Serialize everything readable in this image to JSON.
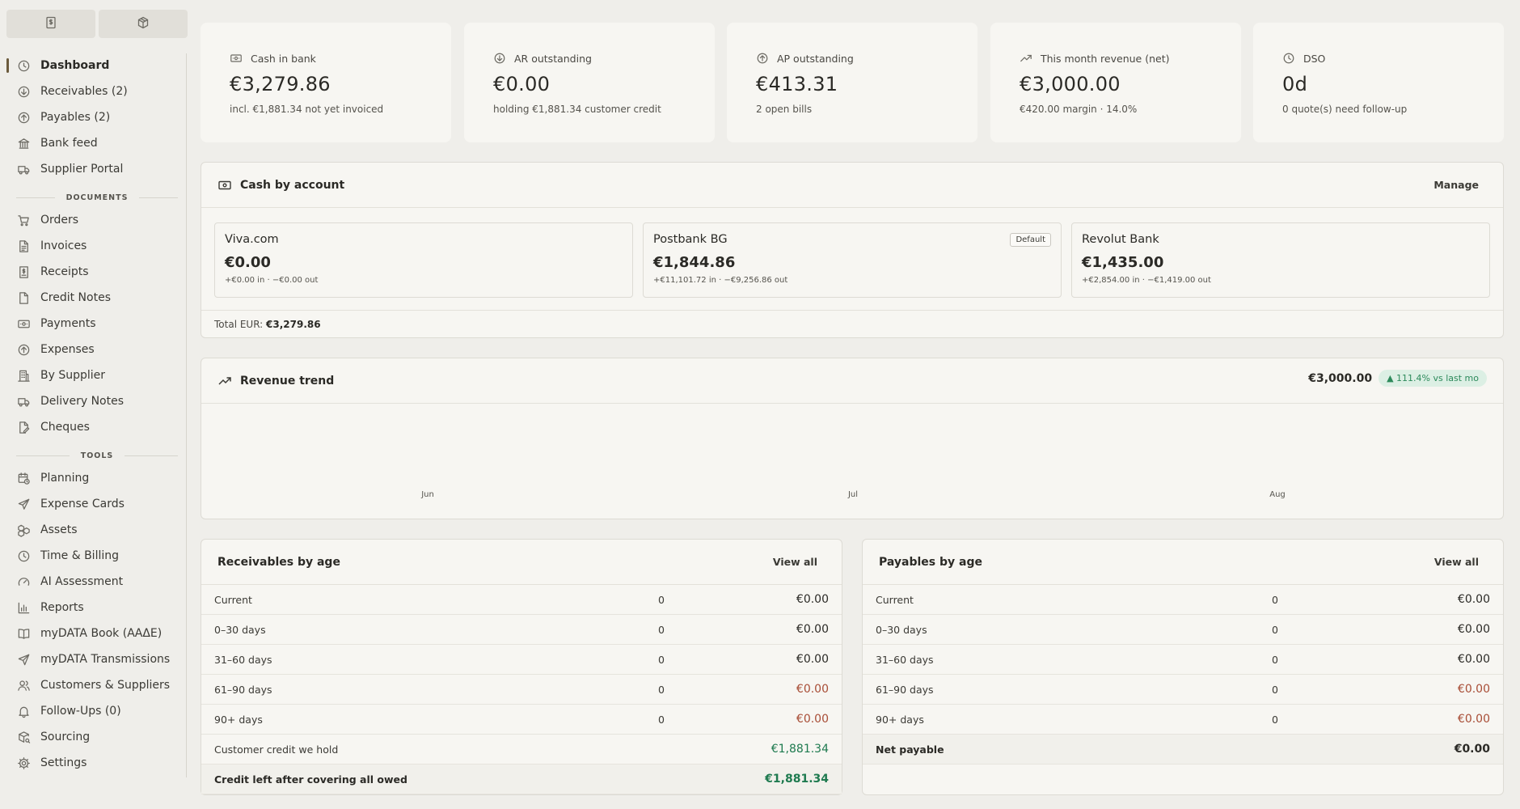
{
  "sidebar": {
    "switch": [
      {
        "icon": "dollar-doc-icon"
      },
      {
        "icon": "box-icon"
      }
    ],
    "main_items": [
      {
        "label": "Dashboard",
        "icon": "clock-icon",
        "active": true
      },
      {
        "label": "Receivables (2)",
        "icon": "arrow-down-circle-icon"
      },
      {
        "label": "Payables (2)",
        "icon": "arrow-up-circle-icon"
      },
      {
        "label": "Bank feed",
        "icon": "bank-icon"
      },
      {
        "label": "Supplier Portal",
        "icon": "truck-icon"
      }
    ],
    "documents_label": "DOCUMENTS",
    "documents": [
      {
        "label": "Orders",
        "icon": "cart-icon"
      },
      {
        "label": "Invoices",
        "icon": "file-text-icon"
      },
      {
        "label": "Receipts",
        "icon": "receipt-icon"
      },
      {
        "label": "Credit Notes",
        "icon": "file-icon"
      },
      {
        "label": "Payments",
        "icon": "banknote-icon"
      },
      {
        "label": "Expenses",
        "icon": "arrow-up-circle-icon"
      },
      {
        "label": "By Supplier",
        "icon": "building-icon"
      },
      {
        "label": "Delivery Notes",
        "icon": "truck-icon"
      },
      {
        "label": "Cheques",
        "icon": "file-edit-icon"
      }
    ],
    "tools_label": "TOOLS",
    "tools": [
      {
        "label": "Planning",
        "icon": "calendar-clock-icon"
      },
      {
        "label": "Expense Cards",
        "icon": "plane-icon"
      },
      {
        "label": "Assets",
        "icon": "boxes-icon"
      },
      {
        "label": "Time & Billing",
        "icon": "clock-icon"
      },
      {
        "label": "AI Assessment",
        "icon": "gauge-icon"
      },
      {
        "label": "Reports",
        "icon": "bar-chart-icon"
      },
      {
        "label": "myDATA Book (ΑΑΔΕ)",
        "icon": "book-icon"
      },
      {
        "label": "myDATA Transmissions",
        "icon": "send-icon"
      },
      {
        "label": "Customers & Suppliers",
        "icon": "users-icon"
      },
      {
        "label": "Follow-Ups (0)",
        "icon": "bell-icon"
      },
      {
        "label": "Sourcing",
        "icon": "package-search-icon"
      },
      {
        "label": "Settings",
        "icon": "gear-icon"
      }
    ]
  },
  "kpis": [
    {
      "label": "Cash in bank",
      "value": "€3,279.86",
      "sub": "incl. €1,881.34 not yet invoiced",
      "icon": "banknote-icon"
    },
    {
      "label": "AR outstanding",
      "value": "€0.00",
      "sub": "holding €1,881.34 customer credit",
      "icon": "arrow-down-circle-icon"
    },
    {
      "label": "AP outstanding",
      "value": "€413.31",
      "sub": "2 open bills",
      "icon": "arrow-up-circle-icon"
    },
    {
      "label": "This month revenue (net)",
      "value": "€3,000.00",
      "sub": "€420.00 margin · 14.0%",
      "icon": "trending-up-icon"
    },
    {
      "label": "DSO",
      "value": "0d",
      "sub": "0 quote(s) need follow-up",
      "icon": "clock-icon"
    }
  ],
  "cash_by_account": {
    "title": "Cash by account",
    "action": "Manage",
    "accounts": [
      {
        "name": "Viva.com",
        "amount": "€0.00",
        "flow": "+€0.00 in · −€0.00 out",
        "badge": ""
      },
      {
        "name": "Postbank BG",
        "amount": "€1,844.86",
        "flow": "+€11,101.72 in · −€9,256.86 out",
        "badge": "Default"
      },
      {
        "name": "Revolut Bank",
        "amount": "€1,435.00",
        "flow": "+€2,854.00 in · −€1,419.00 out",
        "badge": ""
      }
    ],
    "total_label": "Total EUR:",
    "total_value": "€3,279.86"
  },
  "revenue_trend": {
    "title": "Revenue trend",
    "amount": "€3,000.00",
    "change": "▲ 111.4% vs last mo",
    "months": [
      "Jun",
      "Jul",
      "Aug"
    ]
  },
  "receivables": {
    "title": "Receivables by age",
    "action": "View all",
    "rows": [
      {
        "label": "Current",
        "count": "0",
        "amount": "€0.00",
        "tone": ""
      },
      {
        "label": "0–30 days",
        "count": "0",
        "amount": "€0.00",
        "tone": ""
      },
      {
        "label": "31–60 days",
        "count": "0",
        "amount": "€0.00",
        "tone": ""
      },
      {
        "label": "61–90 days",
        "count": "0",
        "amount": "€0.00",
        "tone": "red"
      },
      {
        "label": "90+ days",
        "count": "0",
        "amount": "€0.00",
        "tone": "red"
      },
      {
        "label": "Customer credit we hold",
        "count": "",
        "amount": "€1,881.34",
        "tone": "green"
      },
      {
        "label": "Credit left after covering all owed",
        "count": "",
        "amount": "€1,881.34",
        "tone": "green",
        "bold": true
      }
    ]
  },
  "payables": {
    "title": "Payables by age",
    "action": "View all",
    "rows": [
      {
        "label": "Current",
        "count": "0",
        "amount": "€0.00",
        "tone": ""
      },
      {
        "label": "0–30 days",
        "count": "0",
        "amount": "€0.00",
        "tone": ""
      },
      {
        "label": "31–60 days",
        "count": "0",
        "amount": "€0.00",
        "tone": ""
      },
      {
        "label": "61–90 days",
        "count": "0",
        "amount": "€0.00",
        "tone": "red"
      },
      {
        "label": "90+ days",
        "count": "0",
        "amount": "€0.00",
        "tone": "red"
      },
      {
        "label": "Net payable",
        "count": "",
        "amount": "€0.00",
        "tone": "",
        "bold": true
      }
    ]
  }
}
